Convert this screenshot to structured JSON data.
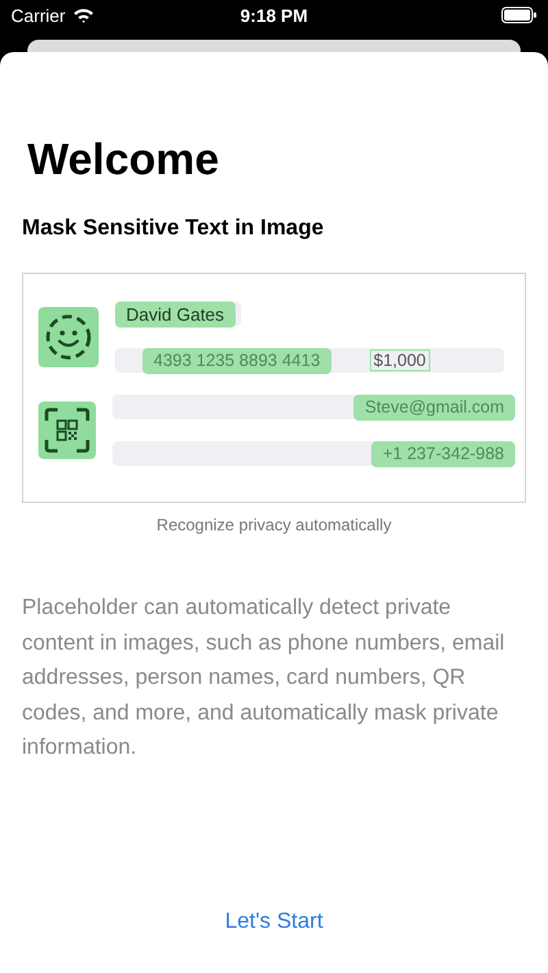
{
  "status_bar": {
    "carrier": "Carrier",
    "time": "9:18 PM"
  },
  "title": "Welcome",
  "subtitle": "Mask Sensitive Text in Image",
  "illustration": {
    "rows": [
      {
        "kind": "short",
        "items": [
          {
            "text": "David Gates",
            "masked": true
          }
        ]
      },
      {
        "kind": "inline",
        "items": [
          {
            "text": "4393 1235 8893 4413",
            "masked": true
          },
          {
            "text": "$1,000",
            "masked": false
          }
        ]
      },
      {
        "kind": "end",
        "items": [
          {
            "text": "Steve@gmail.com",
            "masked": true
          }
        ]
      },
      {
        "kind": "end",
        "items": [
          {
            "text": "+1 237-342-988",
            "masked": true
          }
        ]
      }
    ],
    "caption": "Recognize privacy automatically"
  },
  "description": "Placeholder can automatically detect private content in images, such as phone numbers, email addresses, person names, card numbers, QR codes, and more, and automatically mask private information.",
  "start_button": "Let's Start"
}
